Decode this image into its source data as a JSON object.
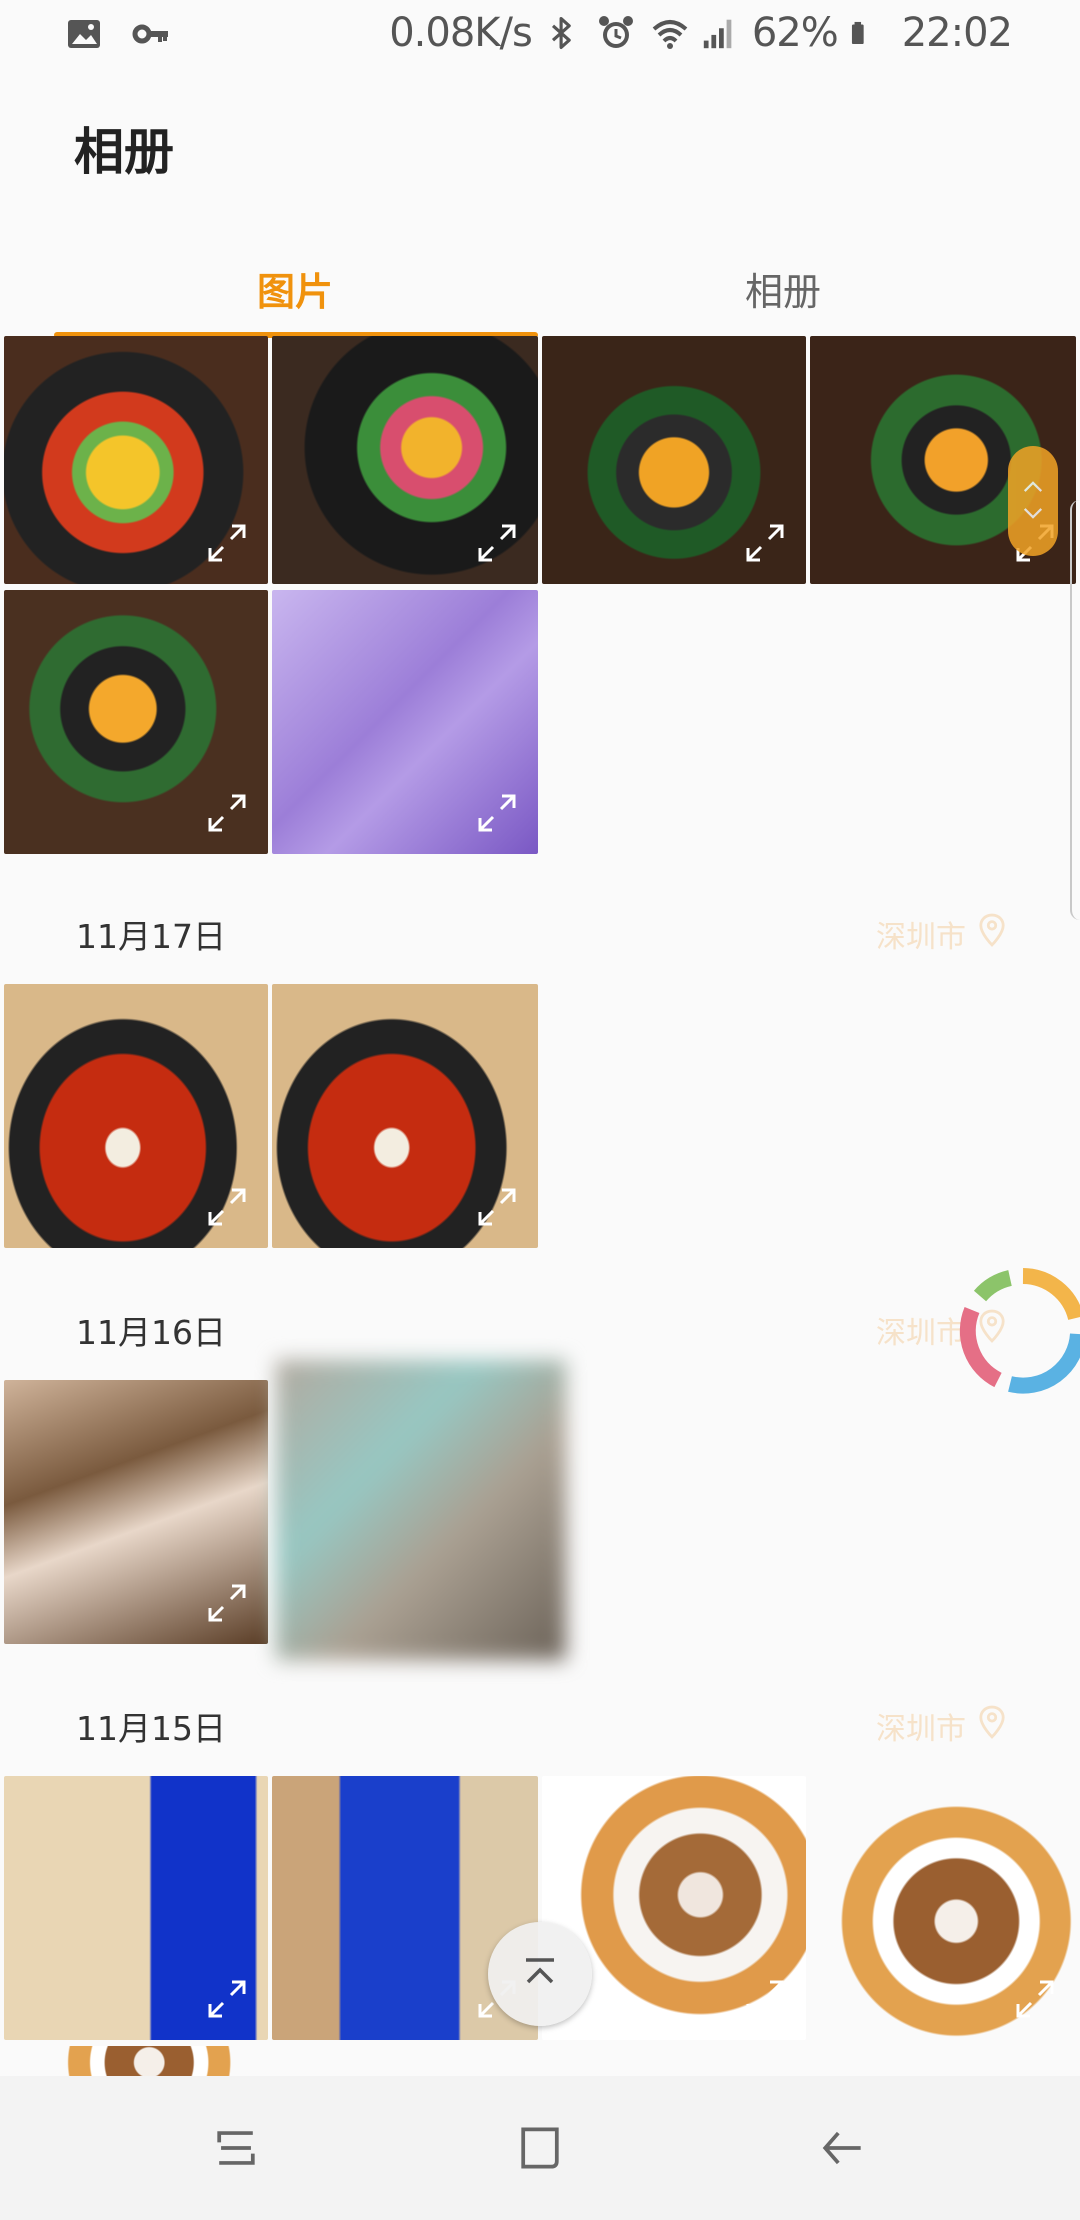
{
  "status_bar": {
    "net_speed": "0.08K/s",
    "battery_percent": "62%",
    "time": "22:02",
    "left_icons": [
      "gallery-icon",
      "key-icon"
    ],
    "right_icons": [
      "bluetooth-icon",
      "alarm-icon",
      "wifi-icon",
      "signal-icon",
      "battery-icon"
    ]
  },
  "header": {
    "title": "相册"
  },
  "tabs": [
    {
      "label": "图片",
      "active": true
    },
    {
      "label": "相册",
      "active": false
    }
  ],
  "sections": [
    {
      "date": "",
      "location": ""
    },
    {
      "date": "11月17日",
      "location": "深圳市"
    },
    {
      "date": "11月16日",
      "location": "深圳市"
    },
    {
      "date": "11月15日",
      "location": "深圳市"
    }
  ],
  "colors": {
    "accent": "#f0920d",
    "background": "#fafafa",
    "location_text": "#f6e2c9"
  }
}
